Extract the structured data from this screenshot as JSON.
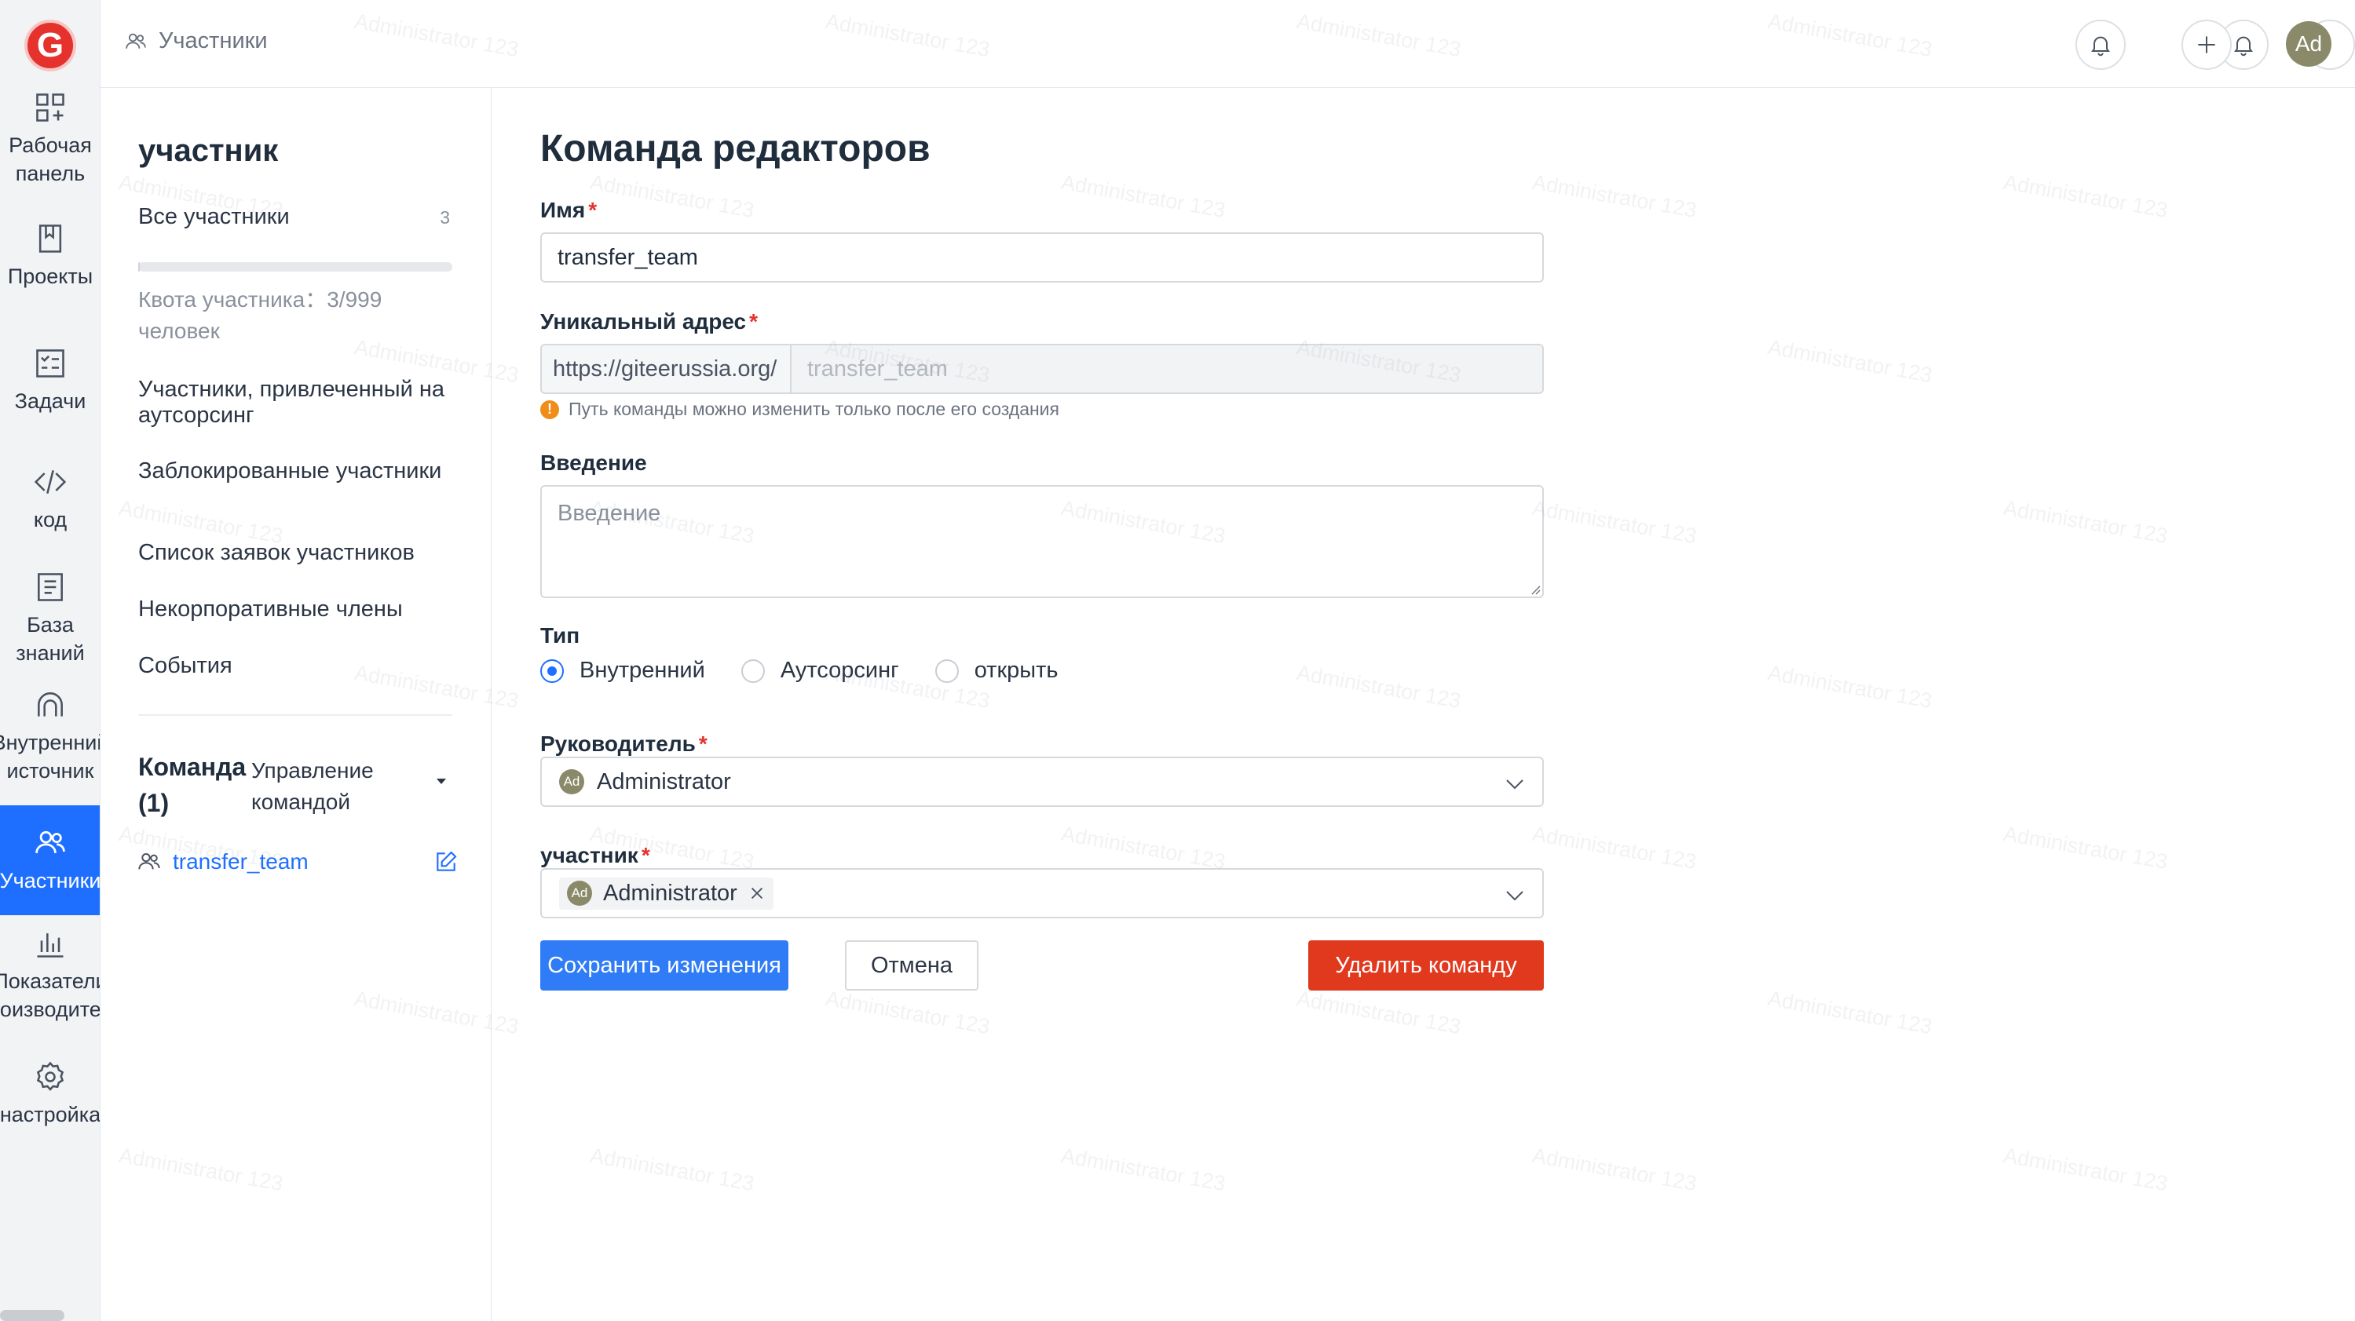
{
  "header": {
    "breadcrumb": "Участники",
    "avatar_initials": "Ad"
  },
  "rail": {
    "logo_letter": "G",
    "items": [
      {
        "label": "Рабочая\nпанель",
        "icon": "dashboard-icon"
      },
      {
        "label": "Проекты",
        "icon": "book-icon"
      },
      {
        "label": "Задачи",
        "icon": "tasks-icon"
      },
      {
        "label": "код",
        "icon": "code-icon"
      },
      {
        "label": "База\nзнаний",
        "icon": "document-icon"
      },
      {
        "label": "Внутренний\nисточник",
        "icon": "source-icon"
      },
      {
        "label": "Участники",
        "icon": "users-icon",
        "active": true
      },
      {
        "label": "Показатели\nпроизводитель",
        "icon": "chart-icon"
      },
      {
        "label": "настройка",
        "icon": "gear-icon"
      }
    ]
  },
  "subside": {
    "title": "участник",
    "all_members": "Все участники",
    "all_members_count": "3",
    "quota_text": "Квота участника：3/999 человек",
    "quota_fraction": 0.003,
    "links": [
      "Участники, привлеченный на аутсорсинг",
      "Заблокированные участники",
      "Список заявок участников",
      "Некорпоративные члены",
      "События"
    ],
    "team_title": "Команда (1)",
    "team_manage": "Управление командой",
    "team_name": "transfer_team"
  },
  "form": {
    "title": "Команда редакторов",
    "name_label": "Имя",
    "name_value": "transfer_team",
    "address_label": "Уникальный адрес",
    "address_prefix": "https://giteerussia.org/",
    "address_value": "transfer_team",
    "address_hint": "Путь команды можно изменить только после его создания",
    "intro_label": "Введение",
    "intro_placeholder": "Введение",
    "type_label": "Тип",
    "types": [
      "Внутренний",
      "Аутсорсинг",
      "открыть"
    ],
    "type_selected": "Внутренний",
    "leader_label": "Руководитель",
    "leader_value": "Administrator",
    "leader_initials": "Ad",
    "member_label": "участник",
    "member_value": "Administrator",
    "member_initials": "Ad",
    "save_label": "Сохранить изменения",
    "cancel_label": "Отмена",
    "delete_label": "Удалить команду"
  },
  "watermark_text": "Administrator 123",
  "colors": {
    "accent": "#1e6fff",
    "primary_button": "#2f7cf6",
    "danger": "#e0391e",
    "logo": "#e5322d",
    "required": "#e5322d"
  }
}
